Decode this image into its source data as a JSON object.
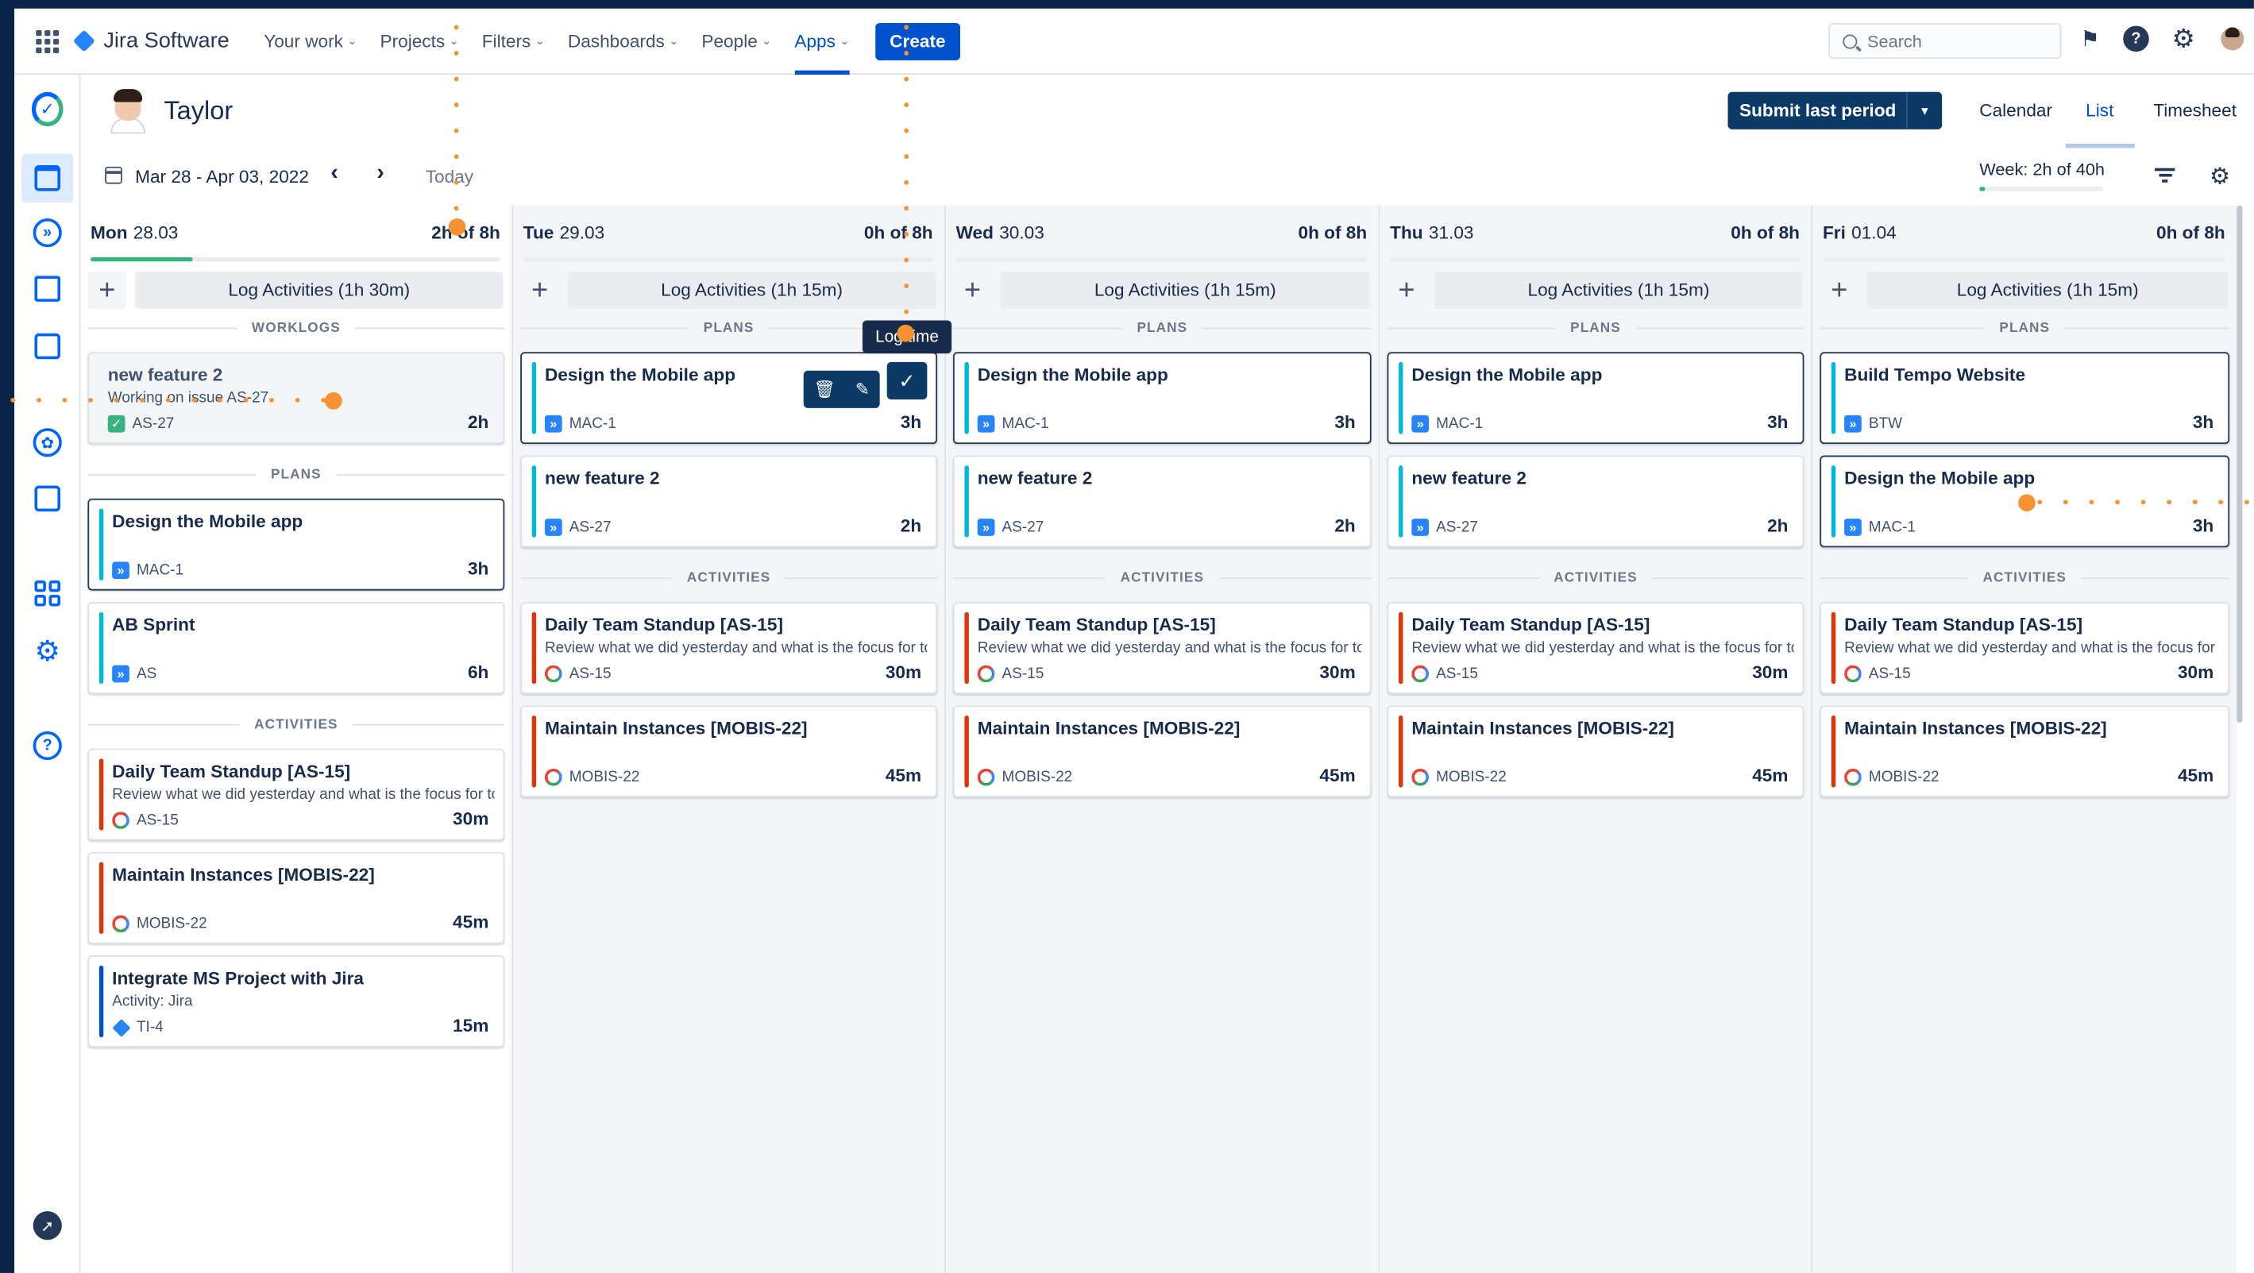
{
  "topnav": {
    "product": "Jira Software",
    "items": [
      "Your work",
      "Projects",
      "Filters",
      "Dashboards",
      "People",
      "Apps"
    ],
    "active_item": "Apps",
    "create_label": "Create",
    "search_placeholder": "Search"
  },
  "header": {
    "user_name": "Taylor",
    "submit_label": "Submit last period",
    "views": [
      "Calendar",
      "List",
      "Timesheet"
    ],
    "active_view": "List",
    "date_range": "Mar 28 - Apr 03, 2022",
    "today_label": "Today",
    "week_label": "Week: 2h of 40h",
    "week_progress": 0.05
  },
  "labels": {
    "worklogs": "WORKLOGS",
    "plans": "PLANS",
    "activities": "ACTIVITIES",
    "tooltip": "Log time"
  },
  "days": [
    {
      "day": "Mon",
      "date": "28.03",
      "hours": "2h of 8h",
      "progress": 0.25,
      "log_label": "Log Activities (1h 30m)",
      "worklogs": [
        {
          "title": "new feature 2",
          "desc": "Working on issue AS-27",
          "issue": "AS-27",
          "dur": "2h"
        }
      ],
      "plans": [
        {
          "title": "Design the Mobile app",
          "issue": "MAC-1",
          "dur": "3h"
        },
        {
          "title": "AB Sprint",
          "issue": "AS",
          "dur": "6h"
        }
      ],
      "activities": [
        {
          "title": "Daily Team Standup [AS-15]",
          "desc": "Review what we did yesterday and what is the focus for today",
          "issue": "AS-15",
          "dur": "30m"
        },
        {
          "title": "Maintain Instances [MOBIS-22]",
          "desc": "",
          "issue": "MOBIS-22",
          "dur": "45m"
        },
        {
          "title": "Integrate MS Project with Jira",
          "desc": "Activity: Jira",
          "issue": "TI-4",
          "dur": "15m"
        }
      ]
    },
    {
      "day": "Tue",
      "date": "29.03",
      "hours": "0h of 8h",
      "progress": 0,
      "log_label": "Log Activities (1h 15m)",
      "plans": [
        {
          "title": "Design the Mobile app",
          "issue": "MAC-1",
          "dur": "3h"
        },
        {
          "title": "new feature 2",
          "issue": "AS-27",
          "dur": "2h"
        }
      ],
      "activities": [
        {
          "title": "Daily Team Standup [AS-15]",
          "desc": "Review what we did yesterday and what is the focus for today",
          "issue": "AS-15",
          "dur": "30m"
        },
        {
          "title": "Maintain Instances [MOBIS-22]",
          "desc": "",
          "issue": "MOBIS-22",
          "dur": "45m"
        }
      ]
    },
    {
      "day": "Wed",
      "date": "30.03",
      "hours": "0h of 8h",
      "progress": 0,
      "log_label": "Log Activities (1h 15m)",
      "plans": [
        {
          "title": "Design the Mobile app",
          "issue": "MAC-1",
          "dur": "3h"
        },
        {
          "title": "new feature 2",
          "issue": "AS-27",
          "dur": "2h"
        }
      ],
      "activities": [
        {
          "title": "Daily Team Standup [AS-15]",
          "desc": "Review what we did yesterday and what is the focus for today",
          "issue": "AS-15",
          "dur": "30m"
        },
        {
          "title": "Maintain Instances [MOBIS-22]",
          "desc": "",
          "issue": "MOBIS-22",
          "dur": "45m"
        }
      ]
    },
    {
      "day": "Thu",
      "date": "31.03",
      "hours": "0h of 8h",
      "progress": 0,
      "log_label": "Log Activities (1h 15m)",
      "plans": [
        {
          "title": "Design the Mobile app",
          "issue": "MAC-1",
          "dur": "3h"
        },
        {
          "title": "new feature 2",
          "issue": "AS-27",
          "dur": "2h"
        }
      ],
      "activities": [
        {
          "title": "Daily Team Standup [AS-15]",
          "desc": "Review what we did yesterday and what is the focus for today",
          "issue": "AS-15",
          "dur": "30m"
        },
        {
          "title": "Maintain Instances [MOBIS-22]",
          "desc": "",
          "issue": "MOBIS-22",
          "dur": "45m"
        }
      ]
    },
    {
      "day": "Fri",
      "date": "01.04",
      "hours": "0h of 8h",
      "progress": 0,
      "log_label": "Log Activities (1h 15m)",
      "plans": [
        {
          "title": "Build Tempo Website",
          "issue": "BTW",
          "dur": "3h"
        },
        {
          "title": "Design the Mobile app",
          "issue": "MAC-1",
          "dur": "3h"
        }
      ],
      "activities": [
        {
          "title": "Daily Team Standup [AS-15]",
          "desc": "Review what we did yesterday and what is the focus for today",
          "issue": "AS-15",
          "dur": "30m"
        },
        {
          "title": "Maintain Instances [MOBIS-22]",
          "desc": "",
          "issue": "MOBIS-22",
          "dur": "45m"
        }
      ]
    }
  ],
  "colors": {
    "accent": "#0052cc",
    "plan_bar": "#00b8d9",
    "activity_bar": "#de350b",
    "progress": "#36b37e",
    "annotation": "#f79232"
  }
}
